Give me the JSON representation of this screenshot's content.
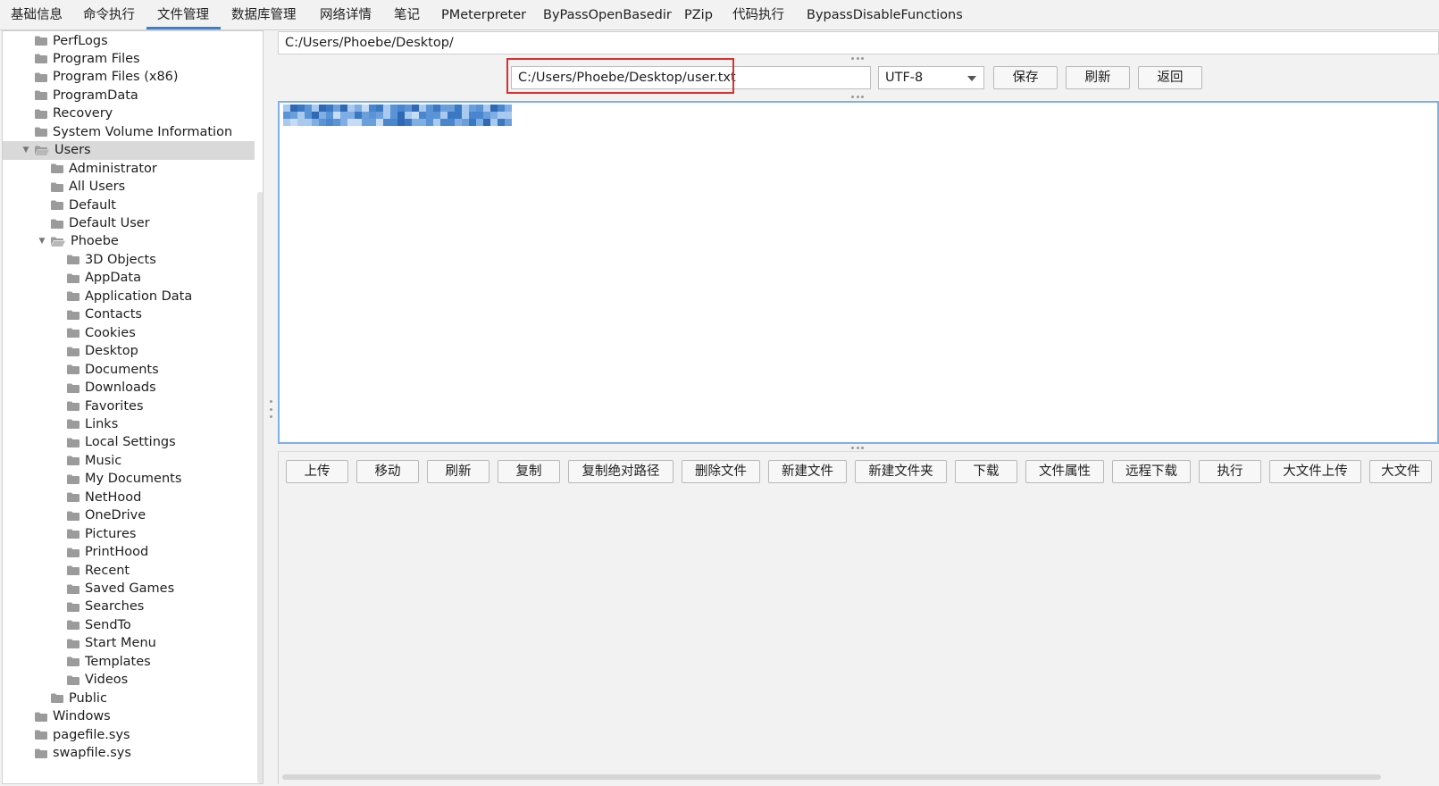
{
  "menu": {
    "tabs": [
      {
        "label": "基础信息"
      },
      {
        "label": "命令执行"
      },
      {
        "label": "文件管理",
        "active": true
      },
      {
        "label": "数据库管理"
      },
      {
        "label": "网络详情"
      },
      {
        "label": "笔记"
      },
      {
        "label": "PMeterpreter"
      },
      {
        "label": "ByPassOpenBasedir"
      },
      {
        "label": "PZip"
      },
      {
        "label": "代码执行"
      },
      {
        "label": "BypassDisableFunctions"
      }
    ]
  },
  "tree": {
    "items": [
      {
        "label": "PerfLogs",
        "level": 1
      },
      {
        "label": "Program Files",
        "level": 1
      },
      {
        "label": "Program Files (x86)",
        "level": 1
      },
      {
        "label": "ProgramData",
        "level": 1
      },
      {
        "label": "Recovery",
        "level": 1
      },
      {
        "label": "System Volume Information",
        "level": 1
      },
      {
        "label": "Users",
        "level": 1,
        "expanded": true,
        "selected": true
      },
      {
        "label": "Administrator",
        "level": 2
      },
      {
        "label": "All Users",
        "level": 2
      },
      {
        "label": "Default",
        "level": 2
      },
      {
        "label": "Default User",
        "level": 2
      },
      {
        "label": "Phoebe",
        "level": 2,
        "expanded": true
      },
      {
        "label": "3D Objects",
        "level": 3
      },
      {
        "label": "AppData",
        "level": 3
      },
      {
        "label": "Application Data",
        "level": 3
      },
      {
        "label": "Contacts",
        "level": 3
      },
      {
        "label": "Cookies",
        "level": 3
      },
      {
        "label": "Desktop",
        "level": 3
      },
      {
        "label": "Documents",
        "level": 3
      },
      {
        "label": "Downloads",
        "level": 3
      },
      {
        "label": "Favorites",
        "level": 3
      },
      {
        "label": "Links",
        "level": 3
      },
      {
        "label": "Local Settings",
        "level": 3
      },
      {
        "label": "Music",
        "level": 3
      },
      {
        "label": "My Documents",
        "level": 3
      },
      {
        "label": "NetHood",
        "level": 3
      },
      {
        "label": "OneDrive",
        "level": 3
      },
      {
        "label": "Pictures",
        "level": 3
      },
      {
        "label": "PrintHood",
        "level": 3
      },
      {
        "label": "Recent",
        "level": 3
      },
      {
        "label": "Saved Games",
        "level": 3
      },
      {
        "label": "Searches",
        "level": 3
      },
      {
        "label": "SendTo",
        "level": 3
      },
      {
        "label": "Start Menu",
        "level": 3
      },
      {
        "label": "Templates",
        "level": 3
      },
      {
        "label": "Videos",
        "level": 3
      },
      {
        "label": "Public",
        "level": 2
      },
      {
        "label": "Windows",
        "level": 1
      },
      {
        "label": "pagefile.sys",
        "level": 1
      },
      {
        "label": "swapfile.sys",
        "level": 1
      }
    ]
  },
  "current_dir": "C:/Users/Phoebe/Desktop/",
  "editor_toolbar": {
    "file_path": "C:/Users/Phoebe/Desktop/user.txt",
    "encoding": "UTF-8",
    "save_label": "保存",
    "refresh_label": "刷新",
    "back_label": "返回"
  },
  "file_actions": [
    {
      "label": "上传"
    },
    {
      "label": "移动"
    },
    {
      "label": "刷新"
    },
    {
      "label": "复制"
    },
    {
      "label": "复制绝对路径"
    },
    {
      "label": "删除文件"
    },
    {
      "label": "新建文件"
    },
    {
      "label": "新建文件夹"
    },
    {
      "label": "下载"
    },
    {
      "label": "文件属性"
    },
    {
      "label": "远程下载"
    },
    {
      "label": "执行"
    },
    {
      "label": "大文件上传"
    },
    {
      "label": "大文件"
    }
  ],
  "colors": {
    "accent": "#3a7fd0",
    "highlight_box": "#d93030",
    "editor_border": "#7fb0e6",
    "selected_row": "#d9d9d9"
  }
}
